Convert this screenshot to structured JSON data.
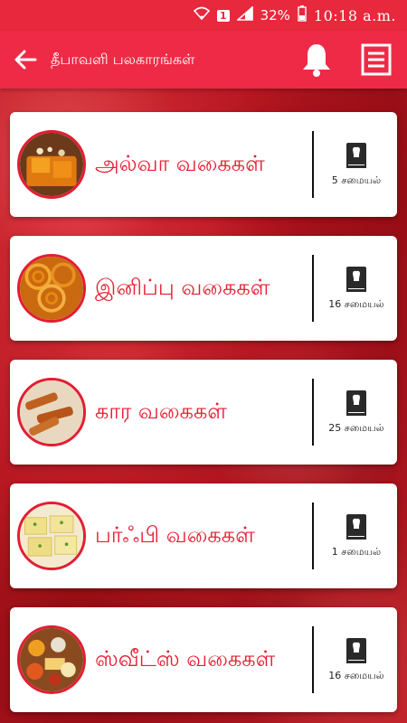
{
  "status": {
    "battery": "32%",
    "time": "10:18 a.m.",
    "sim_badge": "1"
  },
  "app_bar": {
    "title": "தீபாவளி பலகாரங்கள்"
  },
  "categories": [
    {
      "label": "அல்வா வகைகள்",
      "count": "5 சமையல்",
      "thumb": "halwa"
    },
    {
      "label": "இனிப்பு வகைகள்",
      "count": "16 சமையல்",
      "thumb": "jangiri"
    },
    {
      "label": "கார வகைகள்",
      "count": "25 சமையல்",
      "thumb": "savory"
    },
    {
      "label": "பர்ஃபி வகைகள்",
      "count": "1 சமையல்",
      "thumb": "burfi"
    },
    {
      "label": "ஸ்வீட்ஸ் வகைகள்",
      "count": "16 சமையல்",
      "thumb": "sweets"
    }
  ],
  "colors": {
    "accent": "#ee2a46",
    "label": "#e81e34"
  }
}
